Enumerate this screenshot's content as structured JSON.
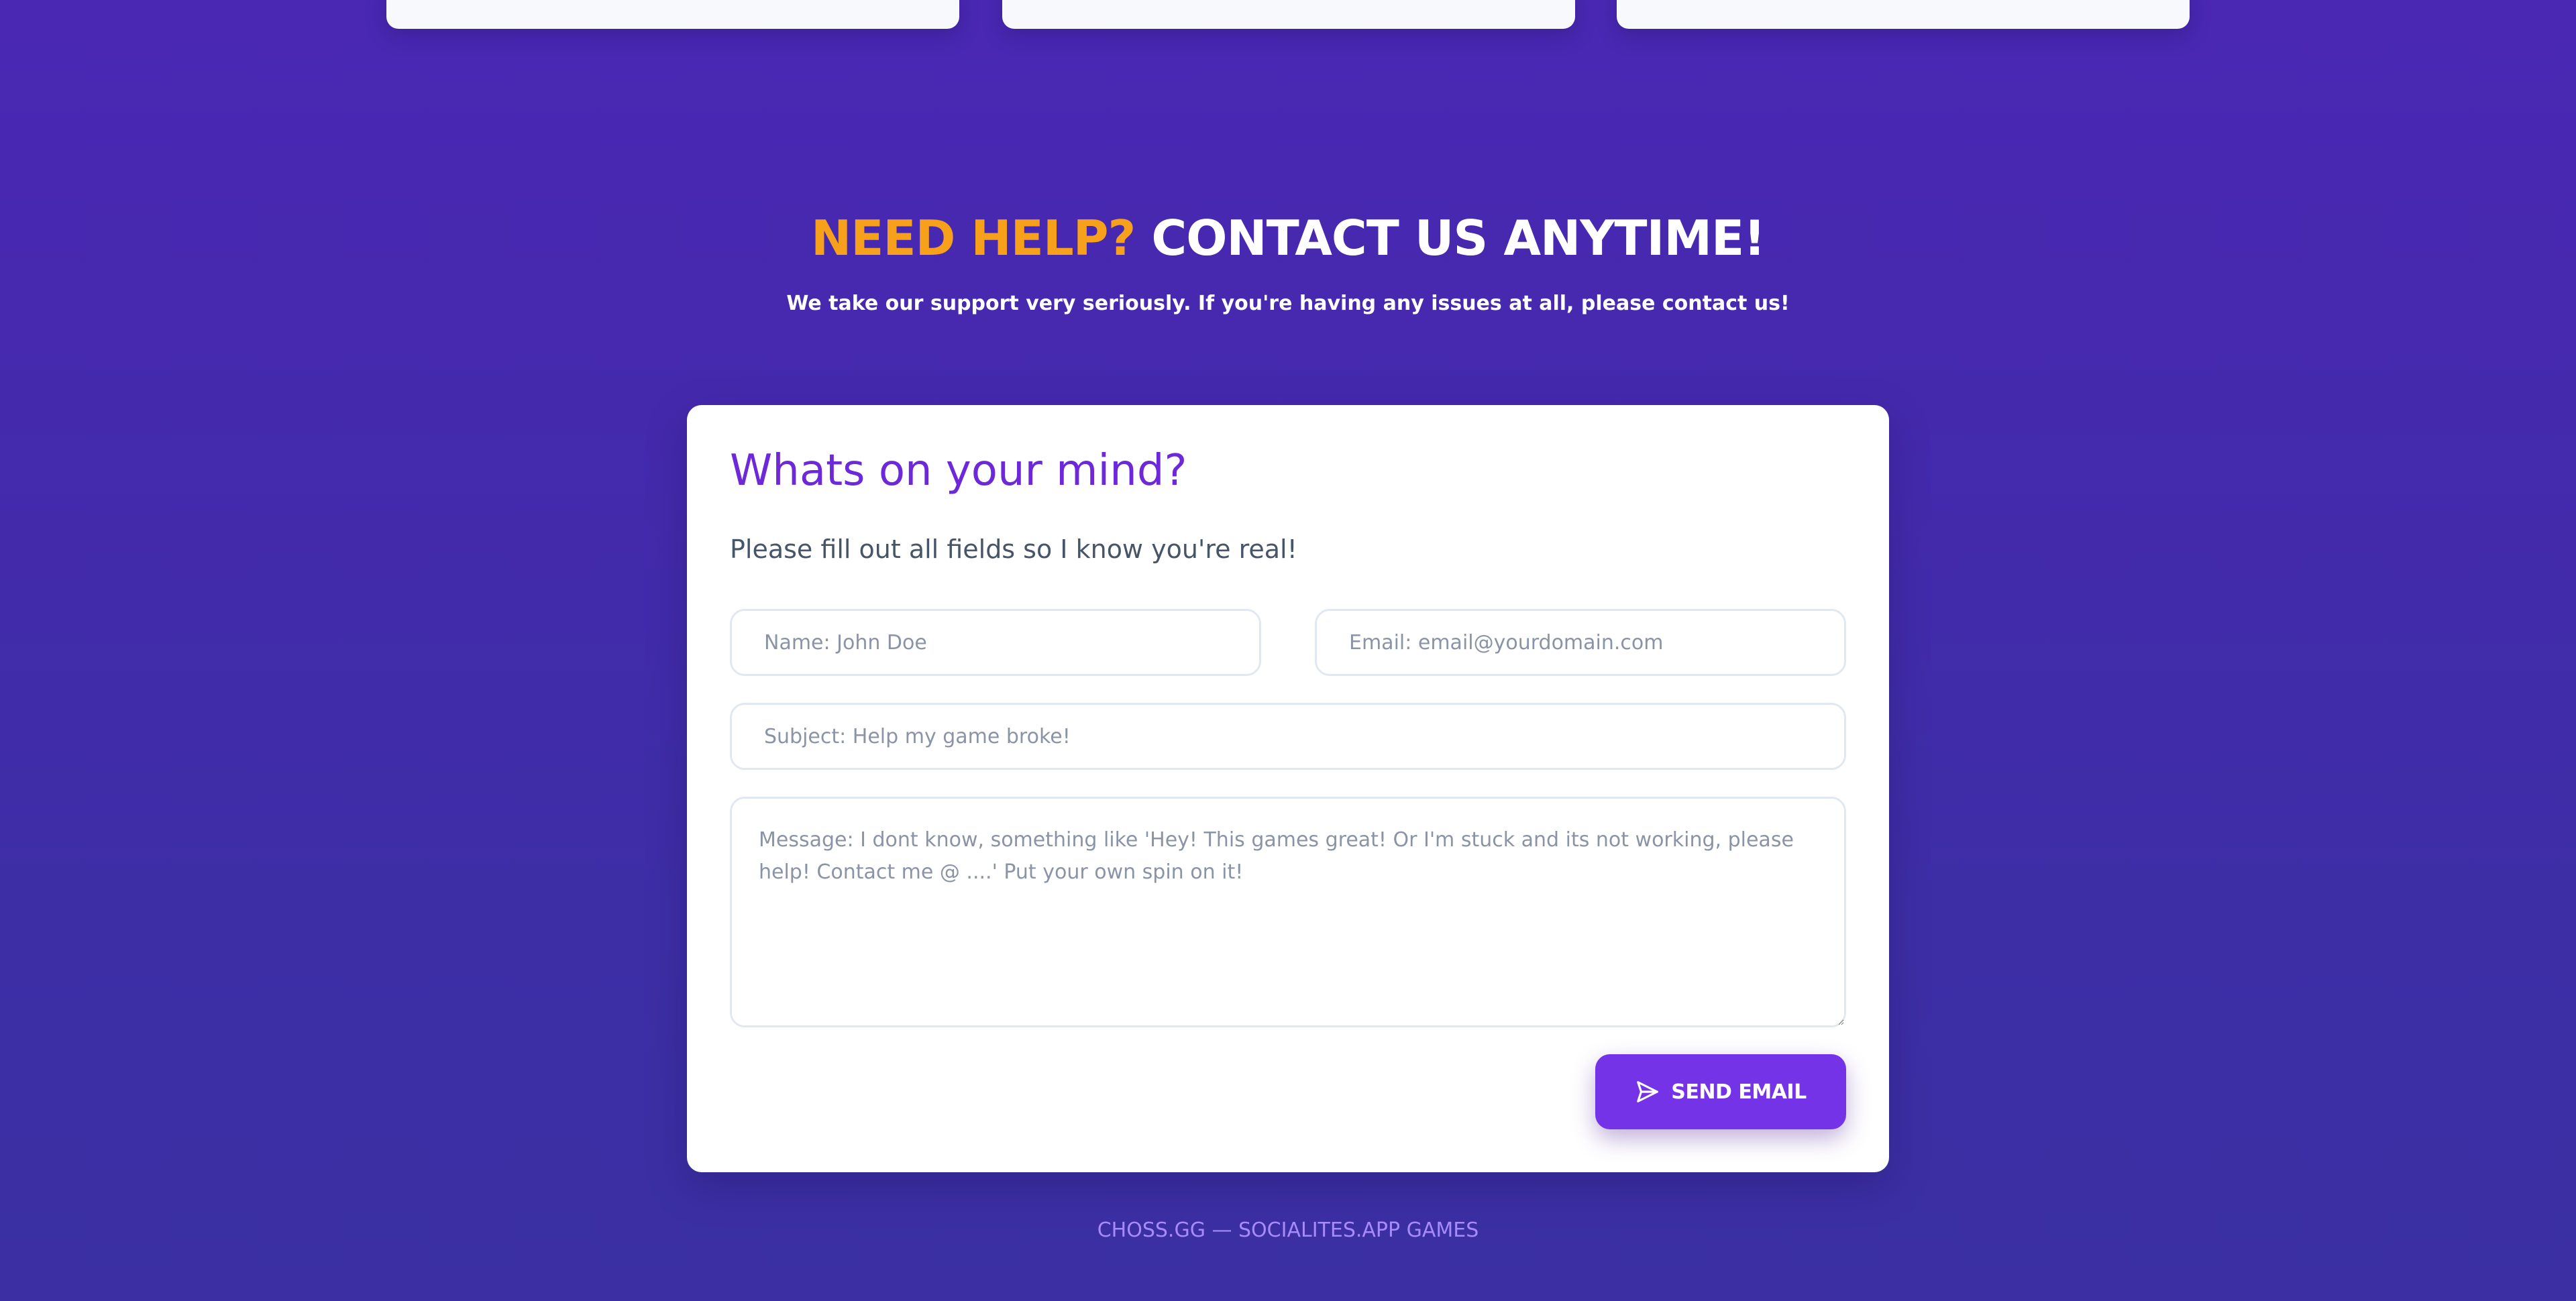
{
  "contact": {
    "heading_accent": "NEED HELP?",
    "heading_main": "CONTACT US ANYTIME!",
    "subtitle": "We take our support very seriously. If you're having any issues at all, please contact us!"
  },
  "form": {
    "title": "Whats on your mind?",
    "instruction": "Please fill out all fields so I know you're real!",
    "name_placeholder": "Name: John Doe",
    "email_placeholder": "Email: email@yourdomain.com",
    "subject_placeholder": "Subject: Help my game broke!",
    "message_placeholder": "Message: I dont know, something like 'Hey! This games great! Or I'm stuck and its not working, please help! Contact me @ ....' Put your own spin on it!",
    "send_label": "SEND EMAIL",
    "send_icon": "send-icon"
  },
  "footer": {
    "text": "CHOSS.GG — SOCIALITES.APP GAMES"
  },
  "colors": {
    "accent_orange": "#f7a01c",
    "brand_purple": "#7433e6",
    "title_purple": "#6d28d9",
    "background": "#4529ad"
  }
}
